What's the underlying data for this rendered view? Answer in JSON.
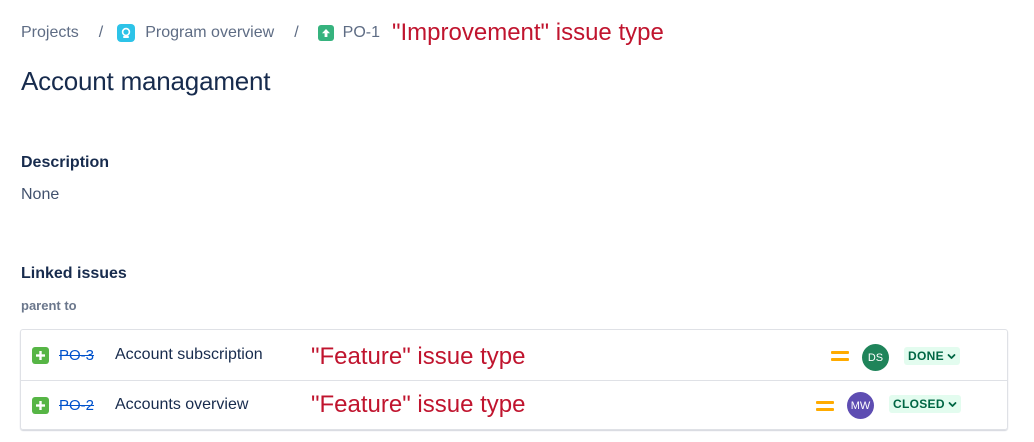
{
  "breadcrumb": {
    "projects": "Projects",
    "separator": "/",
    "project_name": "Program overview",
    "project_icon": "project-avatar-icon",
    "issue_key": "PO-1",
    "issue_type_icon": "improvement-icon"
  },
  "annotations": {
    "parent_type": "\"Improvement\" issue type",
    "child_type_1": "\"Feature\" issue type",
    "child_type_2": "\"Feature\" issue type"
  },
  "issue": {
    "title": "Account managament"
  },
  "description": {
    "heading": "Description",
    "value": "None"
  },
  "linked_issues": {
    "heading": "Linked issues",
    "relation": "parent to",
    "items": [
      {
        "key": "PO-3",
        "summary": "Account subscription",
        "type_icon": "feature-icon",
        "priority_icon": "priority-medium-icon",
        "assignee_initials": "DS",
        "status": "DONE",
        "avatar_color": "#1f845a"
      },
      {
        "key": "PO-2",
        "summary": "Accounts overview",
        "type_icon": "feature-icon",
        "priority_icon": "priority-medium-icon",
        "assignee_initials": "MW",
        "status": "CLOSED",
        "avatar_color": "#5e4db2"
      }
    ]
  },
  "colors": {
    "annotation": "#c0142e",
    "link": "#0052cc",
    "status_done_bg": "#e3fcef",
    "status_done_text": "#006644",
    "priority_medium": "#ffab00"
  }
}
